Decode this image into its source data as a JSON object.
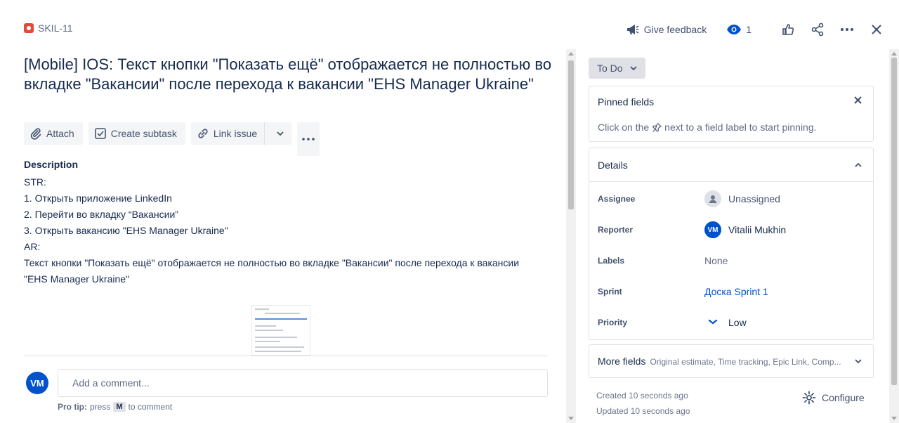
{
  "header": {
    "issue_key": "SKIL-11",
    "give_feedback": "Give feedback",
    "watchers_count": "1"
  },
  "issue": {
    "title": "[Mobile] IOS: Текст кнопки \"Показать ещё\" отображается не полностью во вкладке \"Вакансии\" после перехода к вакансии \"EHS Manager Ukraine\"",
    "toolbar": {
      "attach": "Attach",
      "create_subtask": "Create subtask",
      "link_issue": "Link issue"
    },
    "description_label": "Description",
    "description_lines": [
      "STR:",
      "1. Открыть приложение LinkedIn",
      "2. Перейти во вкладку “Вакансии”",
      "3. Открыть вакансию \"EHS Manager Ukraine\"",
      "AR:",
      "Текст кнопки \"Показать ещё\" отображается не полностью во вкладке \"Вакансии\" после перехода к вакансии \"EHS Manager Ukraine\""
    ]
  },
  "comment": {
    "avatar_initials": "VM",
    "placeholder": "Add a comment...",
    "protip_label": "Pro tip:",
    "protip_press": "press",
    "protip_key": "M",
    "protip_suffix": "to comment"
  },
  "sidebar": {
    "status": "To Do",
    "pinned": {
      "title": "Pinned fields",
      "hint_before": "Click on the",
      "hint_after": "next to a field label to start pinning."
    },
    "details": {
      "title": "Details",
      "fields": [
        {
          "label": "Assignee",
          "value": "Unassigned"
        },
        {
          "label": "Reporter",
          "value": "Vitalii Mukhin",
          "initials": "VM"
        },
        {
          "label": "Labels",
          "value": "None"
        },
        {
          "label": "Sprint",
          "value": "Доска Sprint 1"
        },
        {
          "label": "Priority",
          "value": "Low"
        }
      ]
    },
    "more_fields": {
      "title": "More fields",
      "subtitle": "Original estimate, Time tracking, Epic Link, Comp..."
    },
    "created": "Created 10 seconds ago",
    "updated": "Updated 10 seconds ago",
    "configure": "Configure"
  },
  "colors": {
    "accent": "#0052cc",
    "bug": "#e5493a",
    "text": "#172b4d"
  }
}
